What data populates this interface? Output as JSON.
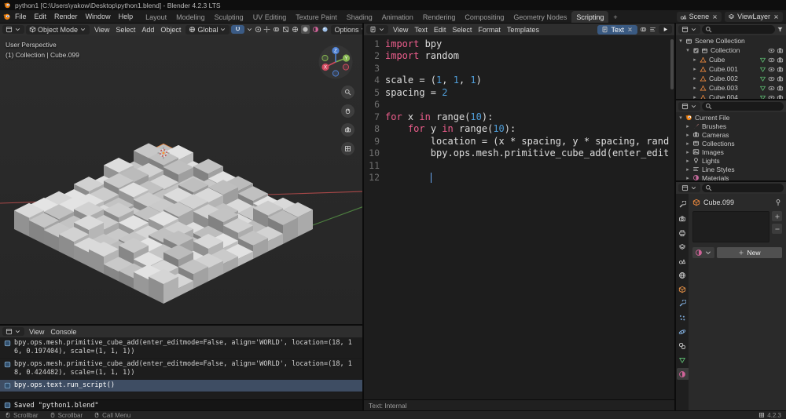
{
  "titlebar": {
    "title": "python1 [C:\\Users\\yakow\\Desktop\\python1.blend] - Blender 4.2.3 LTS"
  },
  "topbar": {
    "menus": [
      "File",
      "Edit",
      "Render",
      "Window",
      "Help"
    ],
    "tabs": [
      "Layout",
      "Modeling",
      "Sculpting",
      "UV Editing",
      "Texture Paint",
      "Shading",
      "Animation",
      "Rendering",
      "Compositing",
      "Geometry Nodes",
      "Scripting"
    ],
    "active_tab": "Scripting",
    "add_tab": "+",
    "scene_label": "Scene",
    "viewlayer_label": "ViewLayer"
  },
  "viewport": {
    "mode": "Object Mode",
    "menus": [
      "View",
      "Select",
      "Add",
      "Object"
    ],
    "orientation": "Global",
    "options_label": "Options",
    "overlay_line1": "User Perspective",
    "overlay_line2": "(1) Collection | Cube.099",
    "axis_labels": {
      "x": "X",
      "y": "Y",
      "z": "Z"
    }
  },
  "text_editor": {
    "menus": [
      "View",
      "Text",
      "Edit",
      "Select",
      "Format",
      "Templates"
    ],
    "datablock": "Text",
    "footer": "Text: Internal",
    "lines": [
      "import bpy",
      "import random",
      "",
      "scale = (1, 1, 1)",
      "spacing = 2",
      "",
      "for x in range(10):",
      "    for y in range(10):",
      "        location = (x * spacing, y * spacing, rand",
      "        bpy.ops.mesh.primitive_cube_add(enter_edit",
      "",
      ""
    ],
    "cursor": {
      "line": 12,
      "column": 8
    }
  },
  "outliner": {
    "root": "Scene Collection",
    "collection": {
      "name": "Collection"
    },
    "objects": [
      "Cube",
      "Cube.001",
      "Cube.002",
      "Cube.003",
      "Cube.004"
    ]
  },
  "file_browser": {
    "root": "Current File",
    "categories": [
      "Brushes",
      "Cameras",
      "Collections",
      "Images",
      "Lights",
      "Line Styles",
      "Materials"
    ]
  },
  "properties": {
    "tabs": [
      "tool",
      "render",
      "output",
      "view-layer",
      "scene",
      "world",
      "object",
      "modifiers",
      "particles",
      "physics",
      "constraints",
      "data",
      "material"
    ],
    "active_tab": "material",
    "object_name": "Cube.099",
    "new_button": "New"
  },
  "console": {
    "menus": [
      "View",
      "Console"
    ],
    "reports": [
      "bpy.ops.mesh.primitive_cube_add(enter_editmode=False, align='WORLD', location=(18, 16, 0.197404), scale=(1, 1, 1))",
      "bpy.ops.mesh.primitive_cube_add(enter_editmode=False, align='WORLD', location=(18, 18, 0.424482), scale=(1, 1, 1))",
      "bpy.ops.text.run_script()"
    ],
    "selected_report": 2,
    "info_line": "Saved \"python1.blend\""
  },
  "statusbar": {
    "hints": [
      {
        "icon": "mouse-left",
        "label": "Scrollbar"
      },
      {
        "icon": "mouse-middle",
        "label": "Scrollbar"
      },
      {
        "icon": "mouse-right",
        "label": "Call Menu"
      }
    ],
    "version": "4.2.3"
  },
  "scene_3d": {
    "grid": {
      "cols": 10,
      "rows": 10
    },
    "cube_top": "#d4d4d4",
    "cube_right": "#b0b0b0",
    "cube_left": "#8e8e8e",
    "axis_x_color": "#a84848",
    "axis_y_color": "#4e8040"
  },
  "colors": {
    "accent": "#4772b3",
    "object_orange": "#e8873e",
    "data_green": "#5cb870",
    "material_pink": "#cf6398"
  }
}
